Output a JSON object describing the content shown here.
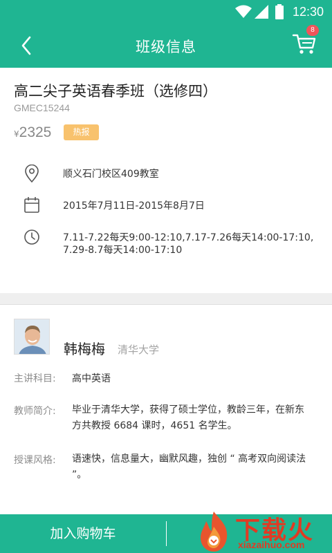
{
  "status_bar": {
    "time": "12:30",
    "icons": [
      "wifi-icon",
      "signal-icon",
      "battery-icon"
    ]
  },
  "app_bar": {
    "title": "班级信息",
    "back_icon": "chevron-left-icon",
    "cart_icon": "cart-icon",
    "cart_badge": "8"
  },
  "course": {
    "name": "高二尖子英语春季班（选修四）",
    "code": "GMEC15244",
    "currency": "¥",
    "price": "2325",
    "tag": "热报",
    "details": [
      {
        "icon": "location-pin-icon",
        "text": "顺义石门校区409教室"
      },
      {
        "icon": "calendar-icon",
        "text": "2015年7月11日-2015年8月7日"
      },
      {
        "icon": "clock-icon",
        "line1": "7.11-7.22每天9:00-12:10,7.17-7.26每天14:00-17:10,",
        "line2": "7.29-8.7每天14:00-17:10"
      }
    ]
  },
  "teacher": {
    "name": "韩梅梅",
    "school": "清华大学",
    "rows": [
      {
        "label": "主讲科目:",
        "line1": "高中英语"
      },
      {
        "label": "教师简介:",
        "line1": "毕业于清华大学，获得了硕士学位，教龄三年，在新东",
        "line2": "方共教授 6684 课时，4651 名学生。"
      },
      {
        "label": "授课风格:",
        "line1": "语速快，信息量大，幽默风趣，独创 “ 高考双向阅读法",
        "line2": "”。"
      }
    ]
  },
  "bottom_bar": {
    "add_to_cart": "加入购物车"
  },
  "watermark": {
    "brand": "下载火",
    "site": "xiazaihuo.com"
  },
  "colors": {
    "primary": "#1fb592",
    "badge": "#f0545a",
    "hot_tag": "#f8c26d",
    "watermark": "#e03b23"
  }
}
